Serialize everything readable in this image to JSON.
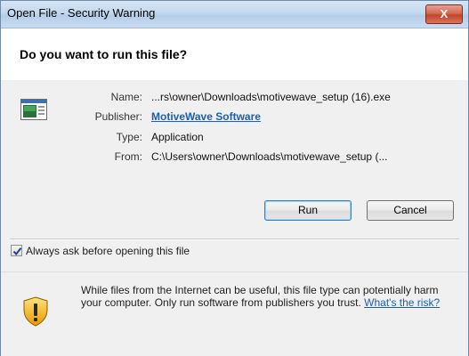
{
  "window": {
    "title": "Open File - Security Warning",
    "close_label": "X"
  },
  "header": {
    "question": "Do you want to run this file?"
  },
  "details": {
    "name_label": "Name:",
    "name_value": "...rs\\owner\\Downloads\\motivewave_setup (16).exe",
    "publisher_label": "Publisher:",
    "publisher_value": "MotiveWave Software",
    "type_label": "Type:",
    "type_value": "Application",
    "from_label": "From:",
    "from_value": "C:\\Users\\owner\\Downloads\\motivewave_setup (..."
  },
  "buttons": {
    "run_label": "Run",
    "cancel_label": "Cancel"
  },
  "options": {
    "always_ask_label": "Always ask before opening this file",
    "always_ask_checked": true
  },
  "warning": {
    "text": "While files from the Internet can be useful, this file type can potentially harm your computer. Only run software from publishers you trust.",
    "link_label": "What's the risk?"
  },
  "icons": {
    "file_icon": "application-file-icon",
    "shield_icon": "warning-shield-icon",
    "check_icon": "checkmark-icon",
    "close_icon": "close-icon"
  },
  "colors": {
    "link": "#1a5fb4",
    "close_button": "#c2442a",
    "titlebar": "#c3d8ee"
  }
}
